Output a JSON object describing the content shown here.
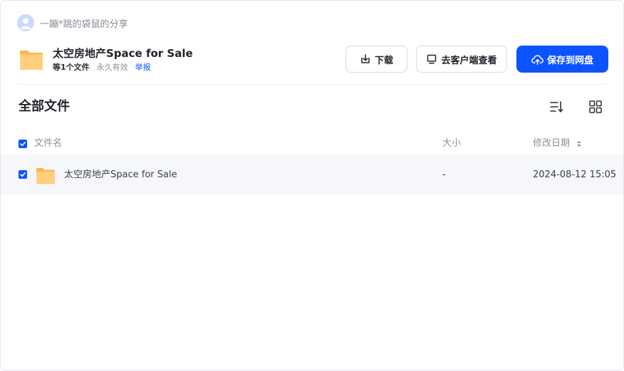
{
  "sharer": {
    "name": "一蹦*跳的袋鼠的分享",
    "avatar_icon": "user-avatar-icon"
  },
  "file": {
    "title": "太空房地产Space for Sale",
    "count": "等1个文件",
    "validity": "永久有效",
    "report": "举报",
    "icon": "folder-icon"
  },
  "actions": {
    "download": "下载",
    "open_client": "去客户端查看",
    "save": "保存到网盘"
  },
  "section": {
    "title": "全部文件"
  },
  "toolbar": {
    "sort_icon": "sort-list-icon",
    "grid_icon": "grid-view-icon"
  },
  "table": {
    "columns": {
      "name": "文件名",
      "size": "大小",
      "modified": "修改日期"
    },
    "rows": [
      {
        "name": "太空房地产Space for Sale",
        "size": "-",
        "modified": "2024-08-12 15:05",
        "checked": true
      }
    ]
  },
  "colors": {
    "accent": "#0d53ff",
    "folder": "#ffc366",
    "row_bg": "#f6f7fb"
  }
}
